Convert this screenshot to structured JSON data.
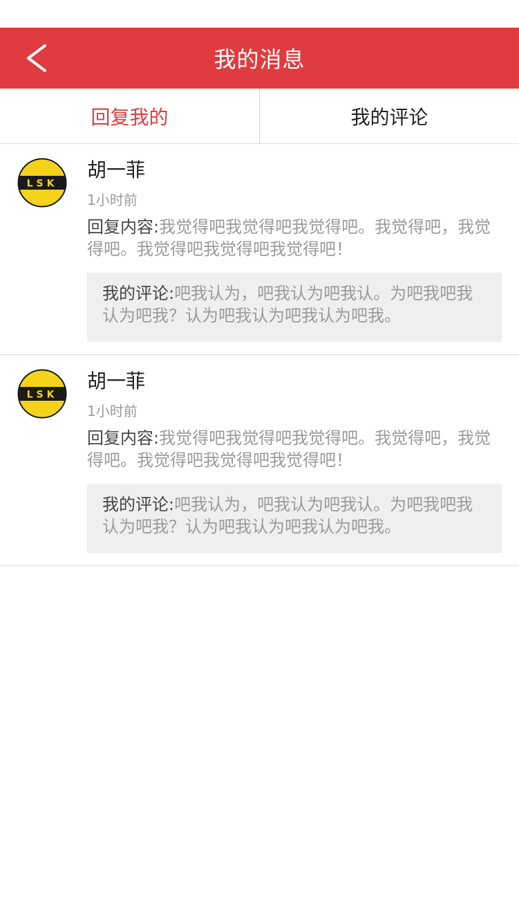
{
  "header": {
    "title": "我的消息"
  },
  "tabs": [
    {
      "label": "回复我的",
      "active": true
    },
    {
      "label": "我的评论",
      "active": false
    }
  ],
  "messages": [
    {
      "name": "胡一菲",
      "avatar_text": "LSK",
      "time": "1小时前",
      "reply_label": "回复内容:",
      "reply_text": "我觉得吧我觉得吧我觉得吧。我觉得吧，我觉得吧。我觉得吧我觉得吧我觉得吧！",
      "comment_label": "我的评论:",
      "comment_text": "吧我认为，吧我认为吧我认。为吧我吧我认为吧我？认为吧我认为吧我认为吧我。"
    },
    {
      "name": "胡一菲",
      "avatar_text": "LSK",
      "time": "1小时前",
      "reply_label": "回复内容:",
      "reply_text": "我觉得吧我觉得吧我觉得吧。我觉得吧，我觉得吧。我觉得吧我觉得吧我觉得吧！",
      "comment_label": "我的评论:",
      "comment_text": "吧我认为，吧我认为吧我认。为吧我吧我认为吧我？认为吧我认为吧我认为吧我。"
    }
  ],
  "colors": {
    "accent": "#e03c3f",
    "avatar_yellow": "#f5d31a",
    "avatar_band": "#1a1a1a"
  }
}
